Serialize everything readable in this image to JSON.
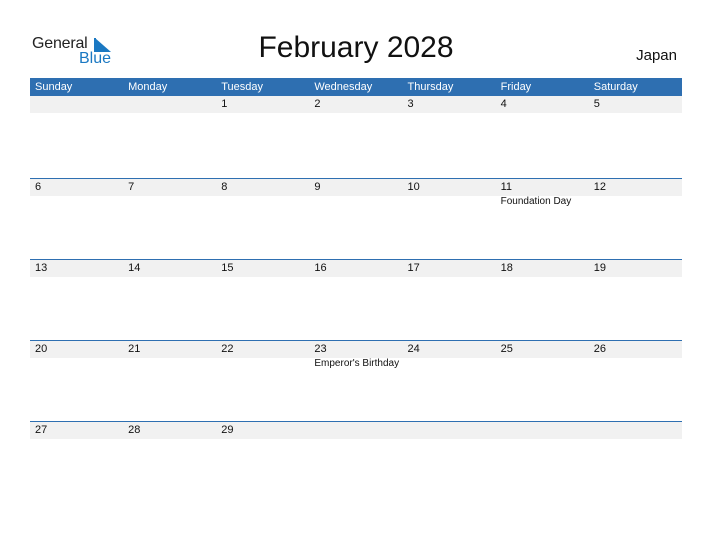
{
  "logo": {
    "general": "General",
    "blue": "Blue"
  },
  "title": "February 2028",
  "country": "Japan",
  "colors": {
    "header_bg": "#2e6fb1",
    "date_strip_bg": "#f1f1f1",
    "logo_blue": "#1a78c2"
  },
  "weekdays": [
    "Sunday",
    "Monday",
    "Tuesday",
    "Wednesday",
    "Thursday",
    "Friday",
    "Saturday"
  ],
  "weeks": [
    [
      {
        "day": ""
      },
      {
        "day": ""
      },
      {
        "day": "1"
      },
      {
        "day": "2"
      },
      {
        "day": "3"
      },
      {
        "day": "4"
      },
      {
        "day": "5"
      }
    ],
    [
      {
        "day": "6"
      },
      {
        "day": "7"
      },
      {
        "day": "8"
      },
      {
        "day": "9"
      },
      {
        "day": "10"
      },
      {
        "day": "11",
        "holiday": "Foundation Day"
      },
      {
        "day": "12"
      }
    ],
    [
      {
        "day": "13"
      },
      {
        "day": "14"
      },
      {
        "day": "15"
      },
      {
        "day": "16"
      },
      {
        "day": "17"
      },
      {
        "day": "18"
      },
      {
        "day": "19"
      }
    ],
    [
      {
        "day": "20"
      },
      {
        "day": "21"
      },
      {
        "day": "22"
      },
      {
        "day": "23",
        "holiday": "Emperor's Birthday"
      },
      {
        "day": "24"
      },
      {
        "day": "25"
      },
      {
        "day": "26"
      }
    ],
    [
      {
        "day": "27"
      },
      {
        "day": "28"
      },
      {
        "day": "29"
      },
      {
        "day": ""
      },
      {
        "day": ""
      },
      {
        "day": ""
      },
      {
        "day": ""
      }
    ]
  ]
}
